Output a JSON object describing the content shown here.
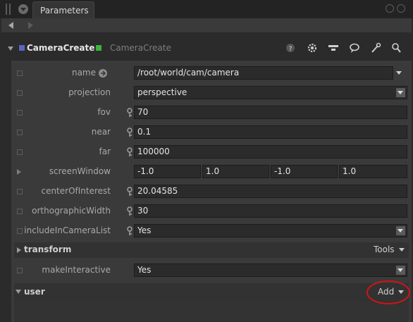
{
  "tab": {
    "title": "Parameters"
  },
  "node": {
    "name": "CameraCreate",
    "type": "CameraCreate",
    "name_color": "#5866c4",
    "status_color": "#3cb43c"
  },
  "header_icons": [
    "help-icon",
    "gear-icon",
    "viewer-icon",
    "comment-icon",
    "wrench-icon",
    "search-icon"
  ],
  "params": {
    "name": {
      "label": "name",
      "value": "/root/world/cam/camera"
    },
    "projection": {
      "label": "projection",
      "value": "perspective"
    },
    "fov": {
      "label": "fov",
      "value": "70"
    },
    "near": {
      "label": "near",
      "value": "0.1"
    },
    "far": {
      "label": "far",
      "value": "100000"
    },
    "screenWindow": {
      "label": "screenWindow",
      "values": [
        "-1.0",
        "1.0",
        "-1.0",
        "1.0"
      ]
    },
    "centerOfInterest": {
      "label": "centerOfInterest",
      "value": "20.04585"
    },
    "orthographicWidth": {
      "label": "orthographicWidth",
      "value": "30"
    },
    "includeInCameraList": {
      "label": "includeInCameraList",
      "value": "Yes"
    }
  },
  "transform": {
    "title": "transform",
    "tools_label": "Tools"
  },
  "makeInteractive": {
    "label": "makeInteractive",
    "value": "Yes"
  },
  "user": {
    "title": "user",
    "add_label": "Add"
  },
  "annotation_color": "#d51313"
}
